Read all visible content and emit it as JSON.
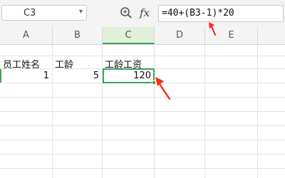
{
  "formula_bar": {
    "name_box": "C3",
    "fx_label": "fx",
    "formula": "=40+(B3-1)*20"
  },
  "columns": [
    "A",
    "B",
    "C",
    "D",
    "E"
  ],
  "active_column": "C",
  "row2": {
    "a": "员工姓名",
    "b": "工龄",
    "c": "工龄工资"
  },
  "row3": {
    "a": "1",
    "b": "5",
    "c": "120"
  },
  "colors": {
    "accent": "#3aa35a",
    "annotation_arrow": "#ff2a1a"
  }
}
